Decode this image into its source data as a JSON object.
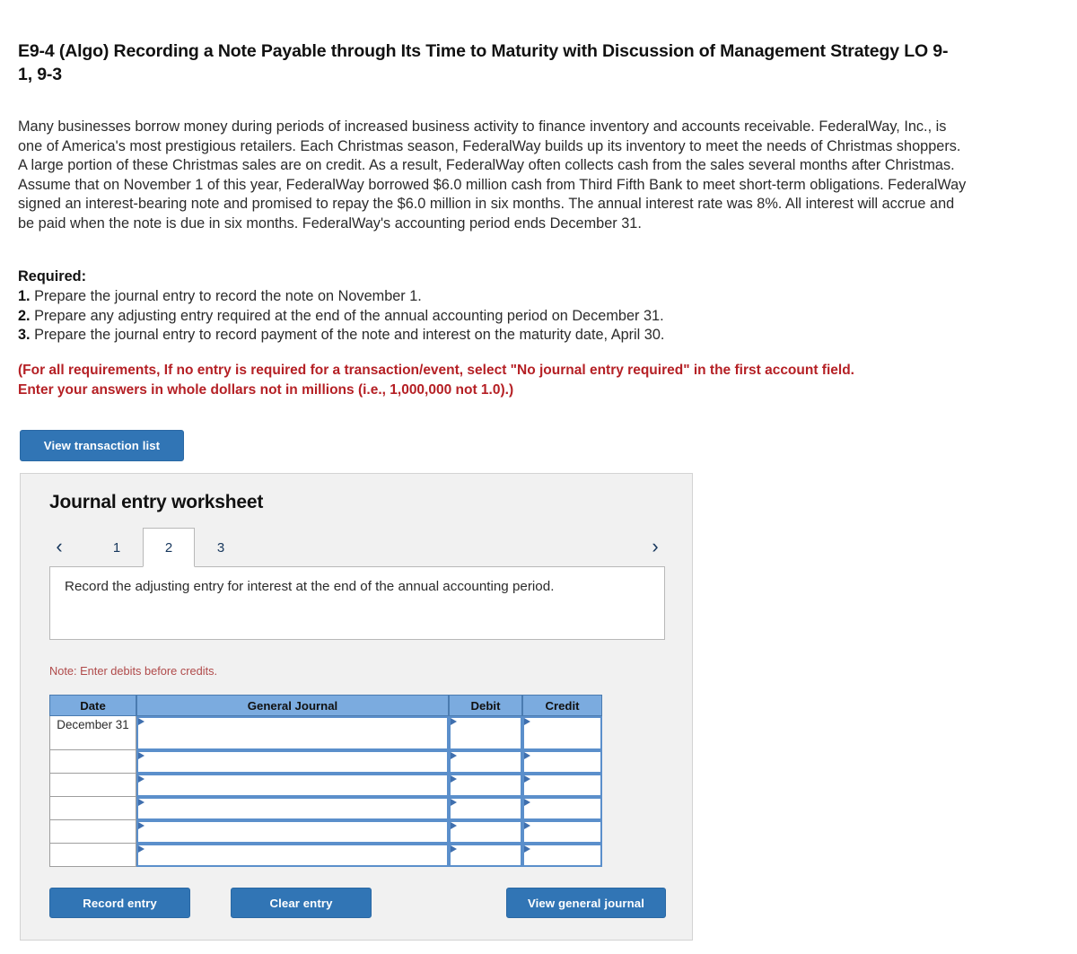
{
  "problem": {
    "title": "E9-4 (Algo) Recording a Note Payable through Its Time to Maturity with Discussion of Management Strategy LO 9-1, 9-3",
    "body": "Many businesses borrow money during periods of increased business activity to finance inventory and accounts receivable. FederalWay, Inc., is one of America's most prestigious retailers. Each Christmas season, FederalWay builds up its inventory to meet the needs of Christmas shoppers. A large portion of these Christmas sales are on credit. As a result, FederalWay often collects cash from the sales several months after Christmas. Assume that on November 1 of this year, FederalWay borrowed $6.0 million cash from Third Fifth Bank to meet short-term obligations. FederalWay signed an interest-bearing note and promised to repay the $6.0 million in six months. The annual interest rate was 8%. All interest will accrue and be paid when the note is due in six months. FederalWay's accounting period ends December 31.",
    "required_heading": "Required:",
    "requirements": [
      {
        "num": "1.",
        "text": "Prepare the journal entry to record the note on November 1."
      },
      {
        "num": "2.",
        "text": "Prepare any adjusting entry required at the end of the annual accounting period on December 31."
      },
      {
        "num": "3.",
        "text": "Prepare the journal entry to record payment of the note and interest on the maturity date, April 30."
      }
    ],
    "red_note_line1": "(For all requirements, If no entry is required for a transaction/event, select \"No journal entry required\" in the first account field.",
    "red_note_line2": "Enter your answers in whole dollars not in millions (i.e., 1,000,000 not 1.0).)"
  },
  "toolbar": {
    "view_transaction_list_label": "View transaction list"
  },
  "worksheet": {
    "title": "Journal entry worksheet",
    "nav": {
      "prev_icon": "chevron-left-icon",
      "next_icon": "chevron-right-icon"
    },
    "tabs": [
      {
        "label": "1",
        "active": false
      },
      {
        "label": "2",
        "active": true
      },
      {
        "label": "3",
        "active": false
      }
    ],
    "instruction": "Record the adjusting entry for interest at the end of the annual accounting period.",
    "note": "Note: Enter debits before credits.",
    "table": {
      "columns": [
        "Date",
        "General Journal",
        "Debit",
        "Credit"
      ],
      "rows": [
        {
          "date": "December 31",
          "general_journal": "",
          "debit": "",
          "credit": ""
        },
        {
          "date": "",
          "general_journal": "",
          "debit": "",
          "credit": ""
        },
        {
          "date": "",
          "general_journal": "",
          "debit": "",
          "credit": ""
        },
        {
          "date": "",
          "general_journal": "",
          "debit": "",
          "credit": ""
        },
        {
          "date": "",
          "general_journal": "",
          "debit": "",
          "credit": ""
        },
        {
          "date": "",
          "general_journal": "",
          "debit": "",
          "credit": ""
        }
      ]
    },
    "buttons": {
      "record_entry": "Record entry",
      "clear_entry": "Clear entry",
      "view_general_journal": "View general journal"
    }
  },
  "colors": {
    "button_blue": "#3175b5",
    "table_header_blue": "#7babdf",
    "input_border_blue": "#5b8fcb",
    "red_note": "#b52025",
    "note_red": "#b04a4a",
    "panel_gray": "#f1f1f1"
  }
}
